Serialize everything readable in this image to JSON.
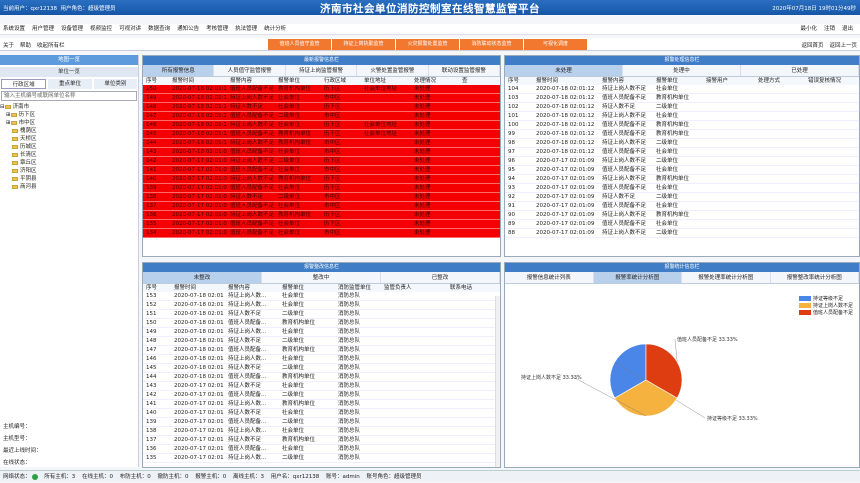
{
  "header": {
    "user": "当前用户：qxr12138",
    "role": "用户角色：超级管理员",
    "title": "济南市社会单位消防控制室在线智慧监管平台",
    "datetime": "2020年07月18日 19时01分49秒"
  },
  "menu": {
    "items": [
      "系统设置",
      "用户管理",
      "设备管理",
      "视频监控",
      "可视对讲",
      "数据查询",
      "通知公告",
      "考核管理",
      "执法管理",
      "统计分析"
    ],
    "minimize": "最小化",
    "logout": "注销",
    "exit": "退出"
  },
  "toolbar": {
    "about": "关于",
    "help": "帮助",
    "close_all": "收起所有栏",
    "buttons": [
      "值班人员值守监管",
      "持证上岗执勤监管",
      "火灾报警处置监管",
      "消防联动状态监管",
      "可视化调度"
    ],
    "home": "返回首页",
    "back": "返回上一页"
  },
  "left": {
    "map_title": "地图一览",
    "unit_list": "单位一览",
    "tabs": [
      "行政区域",
      "重点单位",
      "单位类别"
    ],
    "search_placeholder": "输入主机编号或联网单位名称",
    "tree": [
      {
        "label": "济南市",
        "level": 0
      },
      {
        "label": "历下区",
        "level": 1
      },
      {
        "label": "市中区",
        "level": 1
      },
      {
        "label": "槐荫区",
        "level": 1
      },
      {
        "label": "天桥区",
        "level": 1
      },
      {
        "label": "历城区",
        "level": 1
      },
      {
        "label": "长清区",
        "level": 1
      },
      {
        "label": "章丘区",
        "level": 1
      },
      {
        "label": "济阳区",
        "level": 1
      },
      {
        "label": "平阴县",
        "level": 1
      },
      {
        "label": "商河县",
        "level": 1
      }
    ],
    "info": [
      "主机编号：",
      "主机型号：",
      "最近上线时间：",
      "在线状态："
    ]
  },
  "alarm_panel": {
    "title": "最新报警信息栏",
    "tabs": [
      "所有报警信息",
      "人员值守监管报警",
      "持证上岗监管报警",
      "火警处置监管报警",
      "联动设置监管报警"
    ],
    "headers": [
      "序号",
      "报警时间",
      "报警内容",
      "报警单位",
      "行政区域",
      "单位地址",
      "处理情况",
      "查"
    ],
    "rows": [
      [
        "150",
        "2020-07-18 02:01:12",
        "值班人员配备不足",
        "教育机构单位",
        "历下区",
        "社会单位地址",
        "未处理"
      ],
      [
        "149",
        "2020-07-18 02:01:12",
        "持证上岗人数不足",
        "社会单位",
        "市中区",
        "",
        "未处理"
      ],
      [
        "148",
        "2020-07-18 02:01:12",
        "持证人数不足",
        "社会单位",
        "历下区",
        "",
        "未处理"
      ],
      [
        "147",
        "2020-07-18 02:01:12",
        "值班人员配备不足",
        "二级单位",
        "市中区",
        "",
        "未处理"
      ],
      [
        "146",
        "2020-07-18 02:01:12",
        "持证上岗人数不足",
        "社会单位",
        "历下区",
        "社会单位地址",
        "未处理"
      ],
      [
        "145",
        "2020-07-18 02:01:12",
        "值班人员配备不足",
        "教育机构单位",
        "历下区",
        "社会单位地址",
        "未处理"
      ],
      [
        "144",
        "2020-07-18 02:01:12",
        "持证上岗人数不足",
        "教育机构单位",
        "市中区",
        "",
        "未处理"
      ],
      [
        "143",
        "2020-07-18 02:01:09",
        "值班人员配备不足",
        "社会单位",
        "市中区",
        "",
        "未处理"
      ],
      [
        "142",
        "2020-07-17 02:01:09",
        "持证上岗人数不足",
        "二级单位",
        "历下区",
        "",
        "未处理"
      ],
      [
        "141",
        "2020-07-17 02:01:09",
        "值班人员配备不足",
        "社会单位",
        "市中区",
        "",
        "未处理"
      ],
      [
        "140",
        "2020-07-17 02:01:09",
        "持证上岗人数不足",
        "教育机构单位",
        "历下区",
        "",
        "未处理"
      ],
      [
        "139",
        "2020-07-17 02:01:09",
        "值班人员配备不足",
        "社会单位",
        "历下区",
        "",
        "未处理"
      ],
      [
        "138",
        "2020-07-17 02:01:09",
        "持证人数不足",
        "二级单位",
        "市中区",
        "",
        "未处理"
      ],
      [
        "137",
        "2020-07-17 02:01:09",
        "值班人员配备不足",
        "社会单位",
        "市中区",
        "",
        "未处理"
      ],
      [
        "136",
        "2020-07-17 02:01:09",
        "持证上岗人数不足",
        "教育机构单位",
        "历下区",
        "",
        "未处理"
      ],
      [
        "135",
        "2020-07-17 02:01:09",
        "值班人员配备不足",
        "社会单位",
        "历下区",
        "",
        "未处理"
      ],
      [
        "134",
        "2020-07-17 02:01:09",
        "值班人员配备不足",
        "社会单位",
        "市中区",
        "",
        "未处理"
      ]
    ]
  },
  "handle_panel": {
    "title": "报警处理信息栏",
    "tabs": [
      "未处理",
      "处理中",
      "已处理"
    ],
    "headers": [
      "序号",
      "报警时间",
      "报警内容",
      "报警单位",
      "接警用户",
      "处理方式",
      "错误复核情况"
    ],
    "rows": [
      [
        "104",
        "2020-07-18 02:01:12",
        "持证上岗人数不足",
        "社会单位"
      ],
      [
        "103",
        "2020-07-18 02:01:12",
        "值班人员配备不足",
        "教育机构单位"
      ],
      [
        "102",
        "2020-07-18 02:01:12",
        "持证人数不足",
        "二级单位"
      ],
      [
        "101",
        "2020-07-18 02:01:12",
        "持证上岗人数不足",
        "社会单位"
      ],
      [
        "100",
        "2020-07-18 02:01:12",
        "值班人员配备不足",
        "教育机构单位"
      ],
      [
        "99",
        "2020-07-18 02:01:12",
        "值班人员配备不足",
        "教育机构单位"
      ],
      [
        "98",
        "2020-07-18 02:01:12",
        "持证上岗人数不足",
        "二级单位"
      ],
      [
        "97",
        "2020-07-18 02:01:12",
        "值班人员配备不足",
        "社会单位"
      ],
      [
        "96",
        "2020-07-17 02:01:09",
        "持证上岗人数不足",
        "二级单位"
      ],
      [
        "95",
        "2020-07-17 02:01:09",
        "值班人员配备不足",
        "社会单位"
      ],
      [
        "94",
        "2020-07-17 02:01:09",
        "持证上岗人数不足",
        "教育机构单位"
      ],
      [
        "93",
        "2020-07-17 02:01:09",
        "值班人员配备不足",
        "社会单位"
      ],
      [
        "92",
        "2020-07-17 02:01:09",
        "持证人数不足",
        "二级单位"
      ],
      [
        "91",
        "2020-07-17 02:01:09",
        "值班人员配备不足",
        "社会单位"
      ],
      [
        "90",
        "2020-07-17 02:01:09",
        "持证上岗人数不足",
        "教育机构单位"
      ],
      [
        "89",
        "2020-07-17 02:01:09",
        "值班人员配备不足",
        "社会单位"
      ],
      [
        "88",
        "2020-07-17 02:01:09",
        "持证上岗人数不足",
        "二级单位"
      ]
    ]
  },
  "rectify_panel": {
    "title": "报警整改信息栏",
    "tabs": [
      "未整改",
      "整改中",
      "已整改"
    ],
    "headers": [
      "序号",
      "报警时间",
      "报警内容",
      "报警单位",
      "消防监管单位",
      "监管负责人",
      "联系电话"
    ],
    "rows": [
      [
        "153",
        "2020-07-18 02:01",
        "持证上岗人数...",
        "社会单位",
        "消防总队"
      ],
      [
        "152",
        "2020-07-18 02:01",
        "持证上岗人数...",
        "社会单位",
        "消防总队"
      ],
      [
        "151",
        "2020-07-18 02:01",
        "持证人数不足",
        "二级单位",
        "消防总队"
      ],
      [
        "150",
        "2020-07-18 02:01",
        "值班人员配备...",
        "教育机构单位",
        "消防总队"
      ],
      [
        "149",
        "2020-07-18 02:01",
        "持证上岗人数...",
        "社会单位",
        "消防总队"
      ],
      [
        "148",
        "2020-07-18 02:01",
        "持证人数不足",
        "二级单位",
        "消防总队"
      ],
      [
        "147",
        "2020-07-18 02:01",
        "值班人员配备...",
        "教育机构单位",
        "消防总队"
      ],
      [
        "146",
        "2020-07-18 02:01",
        "持证上岗人数...",
        "社会单位",
        "消防总队"
      ],
      [
        "145",
        "2020-07-18 02:01",
        "持证人数不足",
        "二级单位",
        "消防总队"
      ],
      [
        "144",
        "2020-07-18 02:01",
        "值班人员配备...",
        "教育机构单位",
        "消防总队"
      ],
      [
        "143",
        "2020-07-17 02:01",
        "持证人数不足",
        "社会单位",
        "消防总队"
      ],
      [
        "142",
        "2020-07-17 02:01",
        "值班人员配备...",
        "二级单位",
        "消防总队"
      ],
      [
        "141",
        "2020-07-17 02:01",
        "持证上岗人数...",
        "教育机构单位",
        "消防总队"
      ],
      [
        "140",
        "2020-07-17 02:01",
        "持证人数不足",
        "社会单位",
        "消防总队"
      ],
      [
        "139",
        "2020-07-17 02:01",
        "值班人员配备...",
        "二级单位",
        "消防总队"
      ],
      [
        "138",
        "2020-07-17 02:01",
        "持证上岗人数...",
        "社会单位",
        "消防总队"
      ],
      [
        "137",
        "2020-07-17 02:01",
        "持证人数不足",
        "教育机构单位",
        "消防总队"
      ],
      [
        "136",
        "2020-07-17 02:01",
        "值班人员配备...",
        "社会单位",
        "消防总队"
      ],
      [
        "135",
        "2020-07-17 02:01",
        "持证上岗人数...",
        "二级单位",
        "消防总队"
      ]
    ]
  },
  "stats_panel": {
    "title": "报警统计信息栏",
    "tabs": [
      "报警信息统计列表",
      "报警率统计分析图",
      "报警处理率统计分析图",
      "报警整改率统计分析图"
    ]
  },
  "chart_data": {
    "type": "pie",
    "series": [
      {
        "name": "持证等级不足",
        "value": 33.33,
        "color": "#4a86e8",
        "label": "持证等级不足 33.33%"
      },
      {
        "name": "持证上岗人数不足",
        "value": 33.33,
        "color": "#f6b23e",
        "label": "持证上岗人数不足 33.33%"
      },
      {
        "name": "值班人员配备不足",
        "value": 33.33,
        "color": "#de3d12",
        "label": "值班人员配备不足 33.33%"
      }
    ],
    "legend_position": "top-right"
  },
  "status": {
    "items": [
      "网络状态：",
      "所有主机：3",
      "在线主机：0",
      "布防主机：0",
      "撤防主机：0",
      "报警主机：0",
      "离线主机：3",
      "用户名：qxr12138",
      "账号：admin",
      "账号角色：超级管理员"
    ],
    "online_color": "#2ea043"
  }
}
